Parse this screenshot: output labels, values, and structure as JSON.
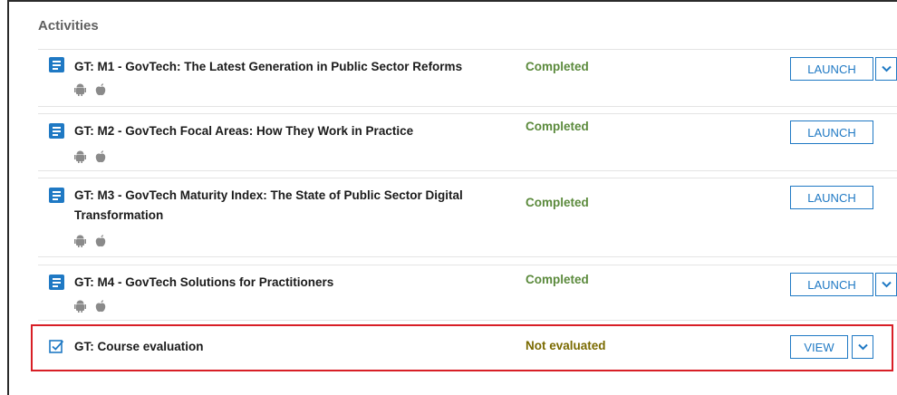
{
  "section_title": "Activities",
  "activities": [
    {
      "title": "GT: M1 - GovTech: The Latest Generation in Public Sector Reforms",
      "status": "Completed",
      "action": "LAUNCH",
      "has_menu": true
    },
    {
      "title": "GT: M2 - GovTech Focal Areas: How They Work in Practice",
      "status": "Completed",
      "action": "LAUNCH",
      "has_menu": false
    },
    {
      "title": "GT: M3 - GovTech Maturity Index: The State of Public Sector Digital Transformation",
      "status": "Completed",
      "action": "LAUNCH",
      "has_menu": false
    },
    {
      "title": "GT: M4 - GovTech Solutions for Practitioners",
      "status": "Completed",
      "action": "LAUNCH",
      "has_menu": true
    },
    {
      "title": "GT: Course evaluation",
      "status": "Not evaluated",
      "action": "VIEW",
      "has_menu": true
    }
  ],
  "colors": {
    "accent": "#1f79c4",
    "completed": "#5b8a3c",
    "not_evaluated": "#7a6a00",
    "highlight": "#d81f26"
  },
  "icons": {
    "document": "document-icon",
    "evaluation": "checkbox-icon",
    "android": "android-icon",
    "apple": "apple-icon",
    "chevron": "chevron-down-icon"
  }
}
